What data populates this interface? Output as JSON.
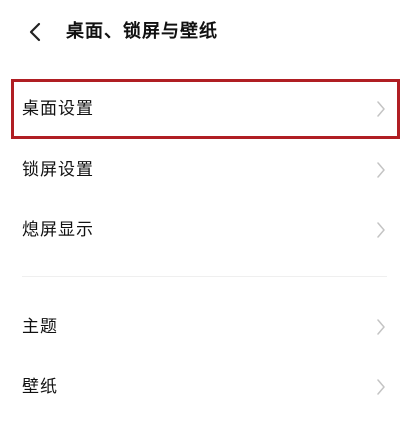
{
  "header": {
    "back_icon": "chevron-left-icon",
    "title": "桌面、锁屏与壁纸"
  },
  "highlight": {
    "color": "#b01e23",
    "target": "桌面设置"
  },
  "section1": {
    "items": [
      {
        "label": "桌面设置",
        "icon": "chevron-right-icon"
      },
      {
        "label": "锁屏设置",
        "icon": "chevron-right-icon"
      },
      {
        "label": "熄屏显示",
        "icon": "chevron-right-icon"
      }
    ]
  },
  "section2": {
    "items": [
      {
        "label": "主题",
        "icon": "chevron-right-icon"
      },
      {
        "label": "壁纸",
        "icon": "chevron-right-icon"
      }
    ]
  },
  "colors": {
    "background": "#ffffff",
    "text": "#111111",
    "chevron": "#c4c4c4"
  }
}
